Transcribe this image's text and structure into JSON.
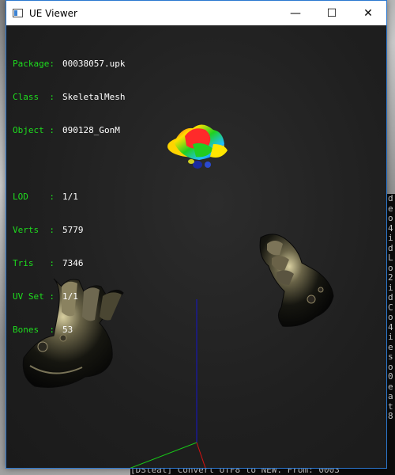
{
  "window": {
    "title": "UE Viewer",
    "controls": {
      "minimize": "—",
      "maximize": "☐",
      "close": "✕"
    }
  },
  "info": {
    "package_label": "Package:",
    "package": "00038057.upk",
    "class_label": "Class  :",
    "class": "SkeletalMesh",
    "object_label": "Object :",
    "object": "090128_GonM",
    "lod_label": "LOD    :",
    "lod": "1/1",
    "verts_label": "Verts  :",
    "verts": "5779",
    "tris_label": "Tris   :",
    "tris": "7346",
    "uvset_label": "UV Set :",
    "uvset": "1/1",
    "bones_label": "Bones  :",
    "bones": "53"
  },
  "colors": {
    "info_label": "#1edc1e",
    "info_value": "#ffffff",
    "axis_x": "#e01010",
    "axis_y": "#10c010",
    "axis_z": "#1010d0"
  },
  "background_console": {
    "bottom_line": "[DSteal] Convert UTF8 to NEW. From: 0003"
  },
  "icons": {
    "app": "app-window-icon"
  }
}
